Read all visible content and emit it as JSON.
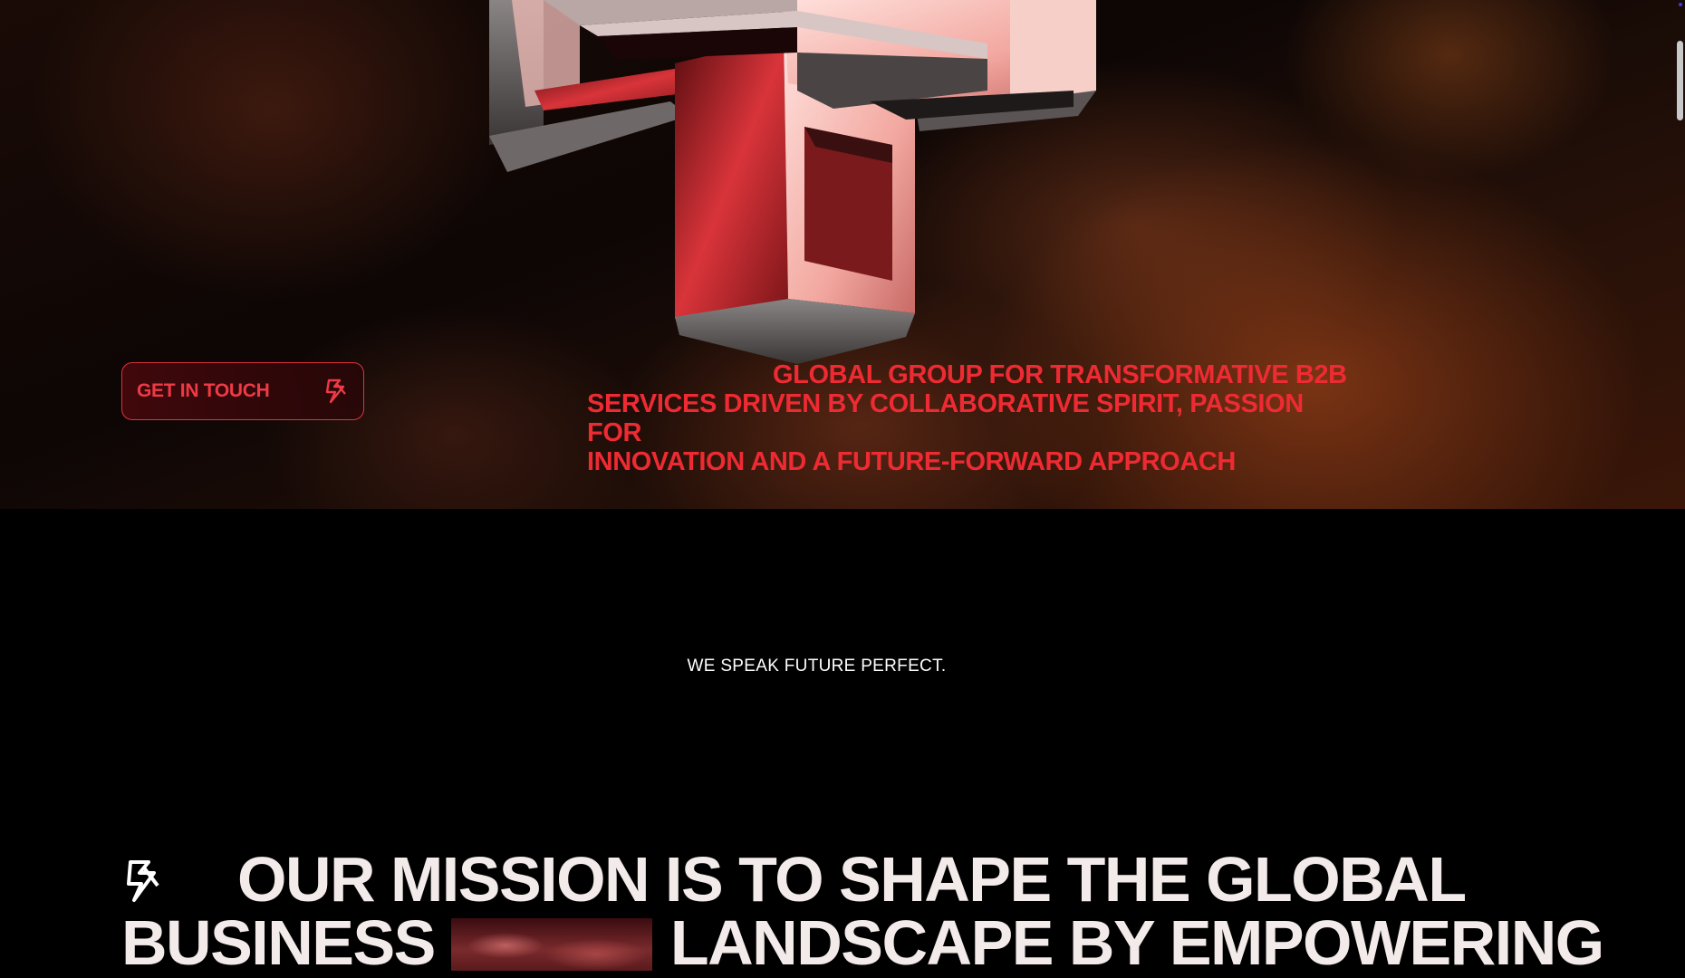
{
  "hero": {
    "cta_label": "GET IN TOUCH",
    "cta_icon": "brand-mark-icon",
    "tagline": {
      "line1": "GLOBAL GROUP FOR TRANSFORMATIVE B2B",
      "line2": "SERVICES DRIVEN BY COLLABORATIVE SPIRIT, PASSION FOR",
      "line3": "INNOVATION AND A FUTURE-FORWARD APPROACH"
    }
  },
  "statement": {
    "text": "WE SPEAK FUTURE PERFECT."
  },
  "mission": {
    "logo_icon": "brand-mark-icon",
    "line1": "OUR MISSION IS TO SHAPE THE GLOBAL",
    "line2_start": "BUSINESS",
    "line2_end": "LANDSCAPE BY EMPOWERING"
  },
  "colors": {
    "accent_red": "#ee2a33",
    "background": "#000000",
    "heading_text": "#f3eaea"
  }
}
